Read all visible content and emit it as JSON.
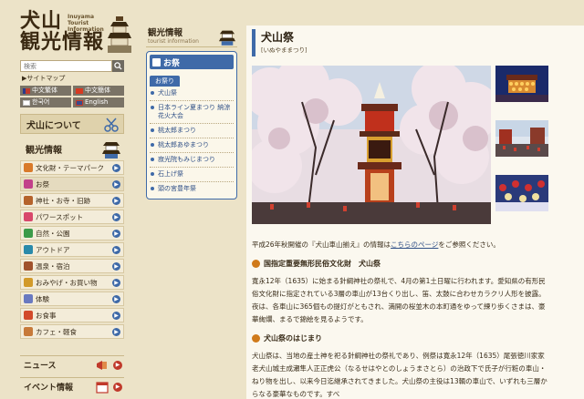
{
  "logo": {
    "title": "犬山\n観光情報",
    "en": "Inuyama\nTourist\nInformation"
  },
  "search": {
    "placeholder": "検索",
    "button_icon": "search-icon"
  },
  "sitemap": "▶サイトマップ",
  "languages": [
    {
      "label": "中文繁体",
      "flag": "taiwan-flag-icon",
      "color": "#c0392b"
    },
    {
      "label": "中文簡体",
      "flag": "china-flag-icon",
      "color": "#d63a22"
    },
    {
      "label": "한국어",
      "flag": "korea-flag-icon",
      "color": "#ffffff"
    },
    {
      "label": "English",
      "flag": "uk-flag-icon",
      "color": "#3a4a8a"
    }
  ],
  "nav": {
    "about": "犬山について",
    "section_title": "観光情報",
    "items": [
      {
        "label": "文化財・テーマパーク",
        "color": "#d97a2a"
      },
      {
        "label": "お祭",
        "color": "#c2408a"
      },
      {
        "label": "神社・お寺・旧跡",
        "color": "#b5632b"
      },
      {
        "label": "パワースポット",
        "color": "#d8486b"
      },
      {
        "label": "自然・公園",
        "color": "#3c9b4a"
      },
      {
        "label": "アウトドア",
        "color": "#2a8aaa"
      },
      {
        "label": "温泉・宿泊",
        "color": "#a0522d"
      },
      {
        "label": "おみやげ・お買い物",
        "color": "#d29a2a"
      },
      {
        "label": "体験",
        "color": "#6a7ac0"
      },
      {
        "label": "お食事",
        "color": "#d24a2a"
      },
      {
        "label": "カフェ・軽食",
        "color": "#c77a3a"
      }
    ],
    "news": "ニュース",
    "events": "イベント情報"
  },
  "sub": {
    "head_jp": "観光情報",
    "head_en": "tourist information",
    "title": "お祭",
    "category": "お祭り",
    "items": [
      "犬山祭",
      "日本ライン夏まつり 納涼花火大会",
      "桃太郎まつり",
      "桃太郎あゆまつり",
      "寂光院もみじまつり",
      "石上げ祭",
      "頭の宮豊年祭"
    ]
  },
  "main": {
    "title": "犬山祭",
    "reading": "[いぬやままつり]",
    "intro_before": "平成26年秋開催の『犬山車山揃え』の情報は",
    "intro_link": "こちらのページ",
    "intro_after": "をご参照ください。",
    "section1": "国指定重要無形民俗文化財　犬山祭",
    "para1": "寛永12年（1635）に始まる針綱神社の祭礼で、4月の第1土日曜に行われます。愛知県の有形民俗文化財に指定されている3層の車山が13台くり出し、笛、太鼓に合わせカラクリ人形を披露。夜は、各車山に365個もの提灯がともされ、満開の桜並木の本町通をゆって練り歩くさまは、豪華絢爛、まるで錦絵を見るようです。",
    "section2": "犬山祭のはじまり",
    "para2": "犬山祭は、当地の産土神を祀る針綱神社の祭礼であり、例祭は寛永12年（1635）尾張徳川家家老犬山城主成瀬隼人正正虎公（なるせはやとのしょうまさとら）の治政下で氏子が行粧の車山・ねり物を出し、以来今日迄継承されてきました。犬山祭の主役は13輌の車山で、いずれも三層からなる豪華なものです。すべ"
  }
}
